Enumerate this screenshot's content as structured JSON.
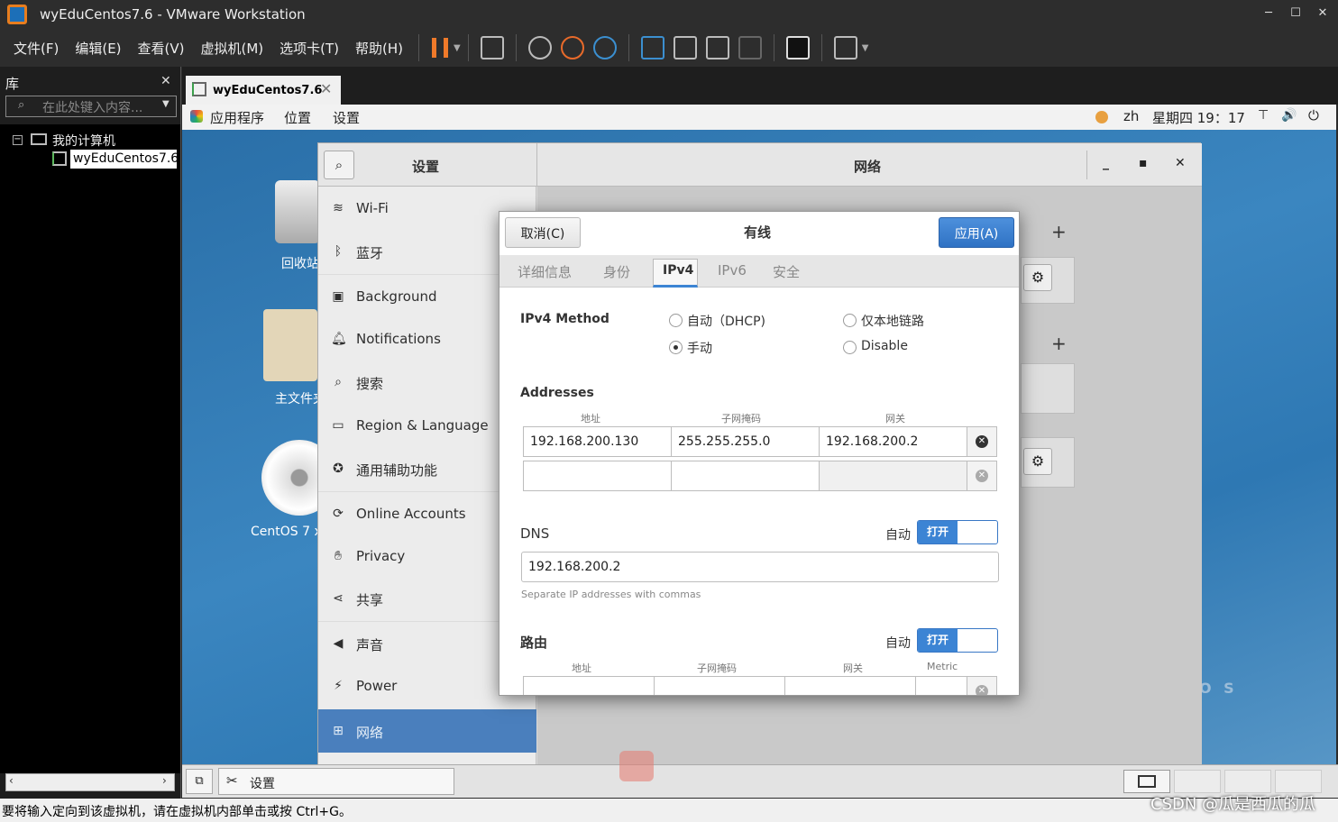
{
  "window": {
    "title": "wyEduCentos7.6 - VMware Workstation"
  },
  "menu": [
    "文件(F)",
    "编辑(E)",
    "查看(V)",
    "虚拟机(M)",
    "选项卡(T)",
    "帮助(H)"
  ],
  "library": {
    "title": "库",
    "search_placeholder": "在此处键入内容...",
    "root": "我的计算机",
    "vm": "wyEduCentos7.6"
  },
  "vm_tab": {
    "label": "wyEduCentos7.6"
  },
  "gnome": {
    "apps": "应用程序",
    "places": "位置",
    "settings": "设置",
    "lang": "zh",
    "clock": "星期四 19：17"
  },
  "desktop": {
    "trash": "回收站",
    "home": "主文件夹",
    "disc": "CentOS 7 x",
    "brand_frag": "O S"
  },
  "settings": {
    "title": "设置",
    "panel_title": "网络",
    "sidebar": [
      "Wi-Fi",
      "蓝牙",
      "Background",
      "Notifications",
      "搜索",
      "Region & Language",
      "通用辅助功能",
      "Online Accounts",
      "Privacy",
      "共享",
      "声音",
      "Power",
      "网络"
    ]
  },
  "dialog": {
    "cancel": "取消(C)",
    "title": "有线",
    "apply": "应用(A)",
    "tabs": [
      "详细信息",
      "身份",
      "IPv4",
      "IPv6",
      "安全"
    ],
    "method_label": "IPv4 Method",
    "methods": [
      "自动（DHCP)",
      "仅本地链路",
      "手动",
      "Disable"
    ],
    "addresses_label": "Addresses",
    "addr_headers": [
      "地址",
      "子网掩码",
      "网关"
    ],
    "addr_row": [
      "192.168.200.130",
      "255.255.255.0",
      "192.168.200.2"
    ],
    "dns_label": "DNS",
    "auto": "自动",
    "toggle_on": "打开",
    "dns_value": "192.168.200.2",
    "dns_hint": "Separate IP addresses with commas",
    "routes_label": "路由",
    "route_headers": [
      "地址",
      "子网掩码",
      "网关",
      "Metric"
    ]
  },
  "taskbar": {
    "settings": "设置"
  },
  "status": "要将输入定向到该虚拟机，请在虚拟机内部单击或按 Ctrl+G。",
  "watermark": "CSDN @瓜是西瓜的瓜"
}
